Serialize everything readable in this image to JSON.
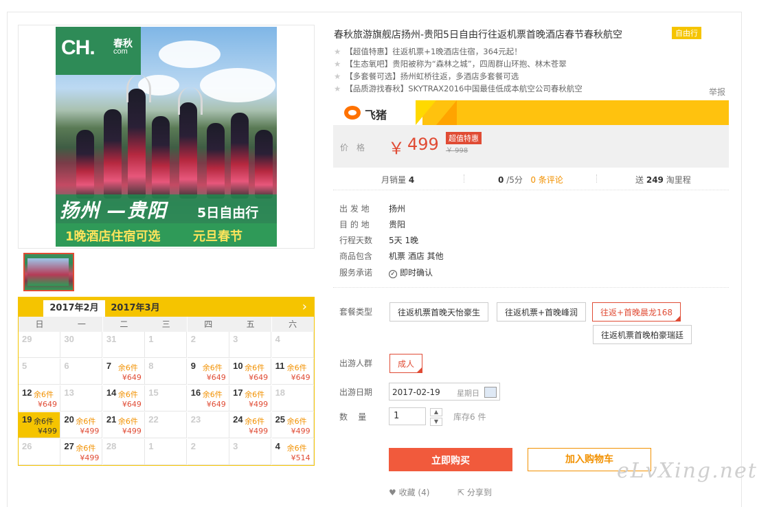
{
  "product": {
    "title": "春秋旅游旗舰店扬州-贵阳5日自由行往返机票首晚酒店春节春秋航空",
    "title_tag": "自由行",
    "features": [
      "【超值特惠】往返机票+1晚酒店住宿，364元起！",
      "【生态氧吧】贵阳被称为“森林之城”，四周群山环抱、林木苍翠",
      "【多套餐可选】扬州虹桥往返，多酒店多套餐可选",
      "【品质游找春秋】SKYTRAX2016中国最佳低成本航空公司春秋航空"
    ],
    "report": "举报"
  },
  "image": {
    "logo_text": "CH.",
    "logo_cn": "春秋",
    "logo_com": "com",
    "route": "扬州 —贵阳",
    "days": "5日自由行",
    "hotel_line": "1晚酒店住宿可选",
    "holiday": "元旦春节"
  },
  "brand": {
    "name": "飞猪"
  },
  "price": {
    "label": "价格",
    "currency": "￥",
    "value": "499",
    "badge": "超值特惠",
    "original": "￥ 998"
  },
  "stats": {
    "sales_label": "月销量",
    "sales_value": "4",
    "rating_value": "0",
    "rating_suffix": "/5分",
    "reviews": "0 条评论",
    "bonus_label": "送",
    "bonus_value": "249",
    "bonus_suffix": "淘里程"
  },
  "info": [
    {
      "key": "出 发 地",
      "value": "扬州"
    },
    {
      "key": "目 的 地",
      "value": "贵阳"
    },
    {
      "key": "行程天数",
      "value": "5天 1晚"
    },
    {
      "key": "商品包含",
      "value": "机票  酒店  其他"
    },
    {
      "key": "服务承诺",
      "value": "即时确认"
    }
  ],
  "options": {
    "package_label": "套餐类型",
    "packages": [
      "往返机票首晚天怡豪生",
      "往返机票+首晚峰润",
      "往返+首晚晨龙168",
      "往返机票首晚柏豪瑞廷"
    ],
    "group_label": "出游人群",
    "group": "成人",
    "date_label": "出游日期",
    "date_value": "2017-02-19",
    "date_weekday": "星期日",
    "qty_label": "数    量",
    "qty_value": "1",
    "stock": "库存6 件"
  },
  "actions": {
    "buy": "立即购买",
    "cart": "加入购物车",
    "fav": "收藏 (4)",
    "share": "分享到"
  },
  "calendar": {
    "tab_active": "2017年2月",
    "tab_next": "2017年3月",
    "next_arrow": "›",
    "weekdays": [
      "日",
      "一",
      "二",
      "三",
      "四",
      "五",
      "六"
    ],
    "weeks": [
      [
        {
          "d": "29"
        },
        {
          "d": "30"
        },
        {
          "d": "31"
        },
        {
          "d": "1"
        },
        {
          "d": "2"
        },
        {
          "d": "3"
        },
        {
          "d": "4"
        }
      ],
      [
        {
          "d": "5"
        },
        {
          "d": "6"
        },
        {
          "d": "7",
          "s": "余6件",
          "p": "¥649"
        },
        {
          "d": "8"
        },
        {
          "d": "9",
          "s": "余6件",
          "p": "¥649"
        },
        {
          "d": "10",
          "s": "余6件",
          "p": "¥649"
        },
        {
          "d": "11",
          "s": "余6件",
          "p": "¥649"
        }
      ],
      [
        {
          "d": "12",
          "s": "余6件",
          "p": "¥649"
        },
        {
          "d": "13"
        },
        {
          "d": "14",
          "s": "余6件",
          "p": "¥649"
        },
        {
          "d": "15"
        },
        {
          "d": "16",
          "s": "余6件",
          "p": "¥649"
        },
        {
          "d": "17",
          "s": "余6件",
          "p": "¥499"
        },
        {
          "d": "18"
        }
      ],
      [
        {
          "d": "19",
          "s": "余6件",
          "p": "¥499",
          "sel": true
        },
        {
          "d": "20",
          "s": "余6件",
          "p": "¥499"
        },
        {
          "d": "21",
          "s": "余6件",
          "p": "¥499"
        },
        {
          "d": "22"
        },
        {
          "d": "23"
        },
        {
          "d": "24",
          "s": "余6件",
          "p": "¥499"
        },
        {
          "d": "25",
          "s": "余6件",
          "p": "¥499"
        }
      ],
      [
        {
          "d": "26"
        },
        {
          "d": "27",
          "s": "余6件",
          "p": "¥499"
        },
        {
          "d": "28"
        },
        {
          "d": "1"
        },
        {
          "d": "2"
        },
        {
          "d": "3"
        },
        {
          "d": "4",
          "s": "余6件",
          "p": "¥514"
        }
      ]
    ]
  },
  "watermark": "eLvXing.net"
}
